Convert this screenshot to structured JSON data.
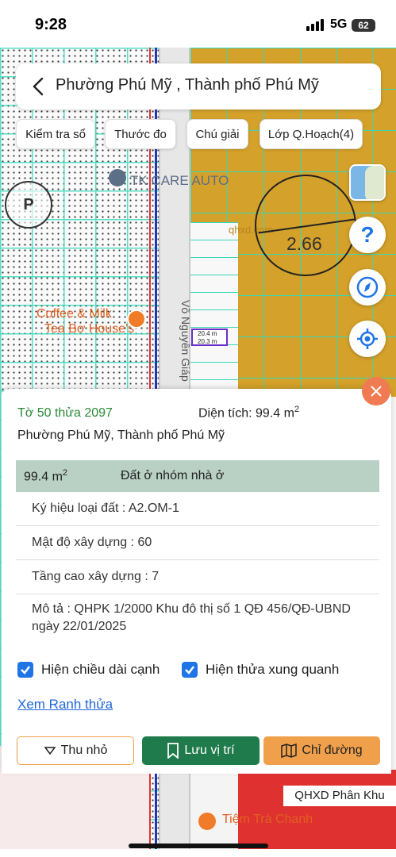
{
  "status_bar": {
    "time": "9:28",
    "network": "5G",
    "battery": "62"
  },
  "header": {
    "title": "Phường Phú Mỹ , Thành phố Phú Mỹ"
  },
  "toolbar": {
    "check_label": "Kiểm tra sổ",
    "measure_label": "Thước đo",
    "legend_label": "Chú giải",
    "layer_label": "Lớp Q.Hoạch(4)"
  },
  "map": {
    "poi_label": "TK CARE AUTO",
    "parking_label": "P",
    "watermark": "qhxd.com",
    "zone_value": "2.66",
    "cafe_label_1": "Coffee & Milk",
    "cafe_label_2": "Tea Bơ House's",
    "street_label": "Võ Nguyên Giáp",
    "edge_label_1": "20.4 m",
    "edge_label_2": "20.3 m",
    "bottom_poi": "Tiệm Trà Chanh",
    "zone_layer_label": "QHXD Phân Khu"
  },
  "panel": {
    "lot_number": "Tờ 50 thửa 2097",
    "area_label": "Diện tích: 99.4 m",
    "area_sup": "2",
    "ward": "Phường Phú Mỹ, Thành phố Phú Mỹ",
    "row_area": "99.4 m",
    "row_area_sup": "2",
    "row_type": "Đất ở nhóm nhà ở",
    "land_code": "Ký hiệu loại đất : A2.OM-1",
    "density": "Mật độ xây dựng : 60",
    "floors": "Tầng cao xây dựng : 7",
    "description": "Mô tả : QHPK 1/2000 Khu đô thị số 1 QĐ 456/QĐ-UBND ngày 22/01/2025",
    "checkbox_edges": "Hiện chiều dài cạnh",
    "checkbox_neighbors": "Hiện thửa xung quanh",
    "link_label": "Xem Ranh thửa",
    "btn_collapse": "Thu nhỏ",
    "btn_save": "Lưu vị trí",
    "btn_directions": "Chỉ đường"
  },
  "colors": {
    "accent_green": "#1f7a4c",
    "accent_orange": "#f0a04b",
    "header_row": "#b9d0c5",
    "lot_green": "#2a8a35",
    "link_blue": "#2167d9"
  }
}
